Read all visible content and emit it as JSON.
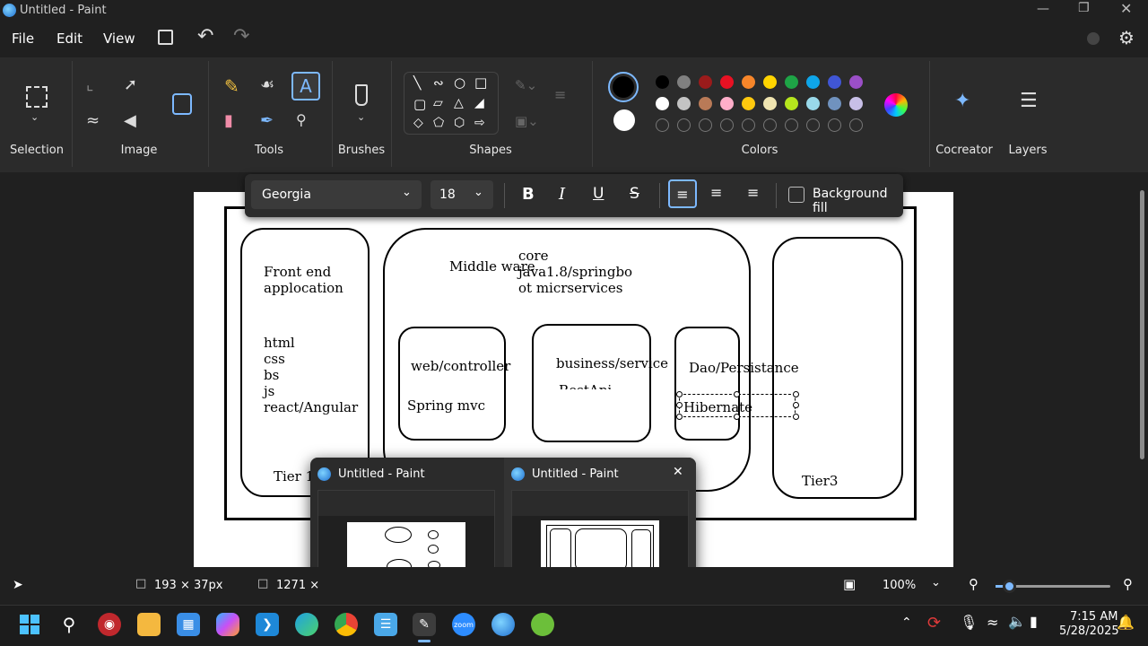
{
  "window": {
    "title": "Untitled - Paint"
  },
  "menu": {
    "file": "File",
    "edit": "Edit",
    "view": "View"
  },
  "ribbon": {
    "groups": {
      "selection": "Selection",
      "image": "Image",
      "tools": "Tools",
      "brushes": "Brushes",
      "shapes": "Shapes",
      "colors": "Colors",
      "cocreator": "Cocreator",
      "layers": "Layers"
    },
    "palette_row1": [
      "#000000",
      "#808080",
      "#9b1b1b",
      "#e81123",
      "#f7862a",
      "#ffd400",
      "#1ea446",
      "#0ea5e9",
      "#4056d6",
      "#9b4fc7"
    ],
    "palette_row2": [
      "#ffffff",
      "#c3c3c3",
      "#b97a57",
      "#ffaec9",
      "#ffc90e",
      "#efe4b0",
      "#b5e61d",
      "#99d9ea",
      "#7092be",
      "#c8bfe7"
    ],
    "primary_color": "#000000",
    "secondary_color": "#ffffff"
  },
  "textbar": {
    "font": "Georgia",
    "size": "18",
    "bold": "B",
    "italic": "I",
    "underline": "U",
    "strike": "S",
    "background_fill": "Background fill"
  },
  "canvas": {
    "front_end_title": "Front end\napplocation",
    "front_end_list": "html\ncss\nbs\njs\nreact/Angular",
    "tier1": "Tier 1",
    "middleware": "Middle ware",
    "core": "core\njava1.8/springbo\not micrservices",
    "web": "web/controller",
    "spring_mvc": "Spring mvc",
    "business": "business/service",
    "rest": "RestApi",
    "dao": "Dao/Persistance",
    "hibernate": "Hibernate",
    "tier3": "Tier3"
  },
  "popup": {
    "item1_title": "Untitled - Paint",
    "item2_title": "Untitled - Paint"
  },
  "status": {
    "selection_size": "193 × 37px",
    "canvas_size": "1271 × ",
    "zoom": "100%",
    "zoom_fraction": 0.12
  },
  "taskbar": {
    "time": "7:15 AM",
    "date": "5/28/2025"
  }
}
